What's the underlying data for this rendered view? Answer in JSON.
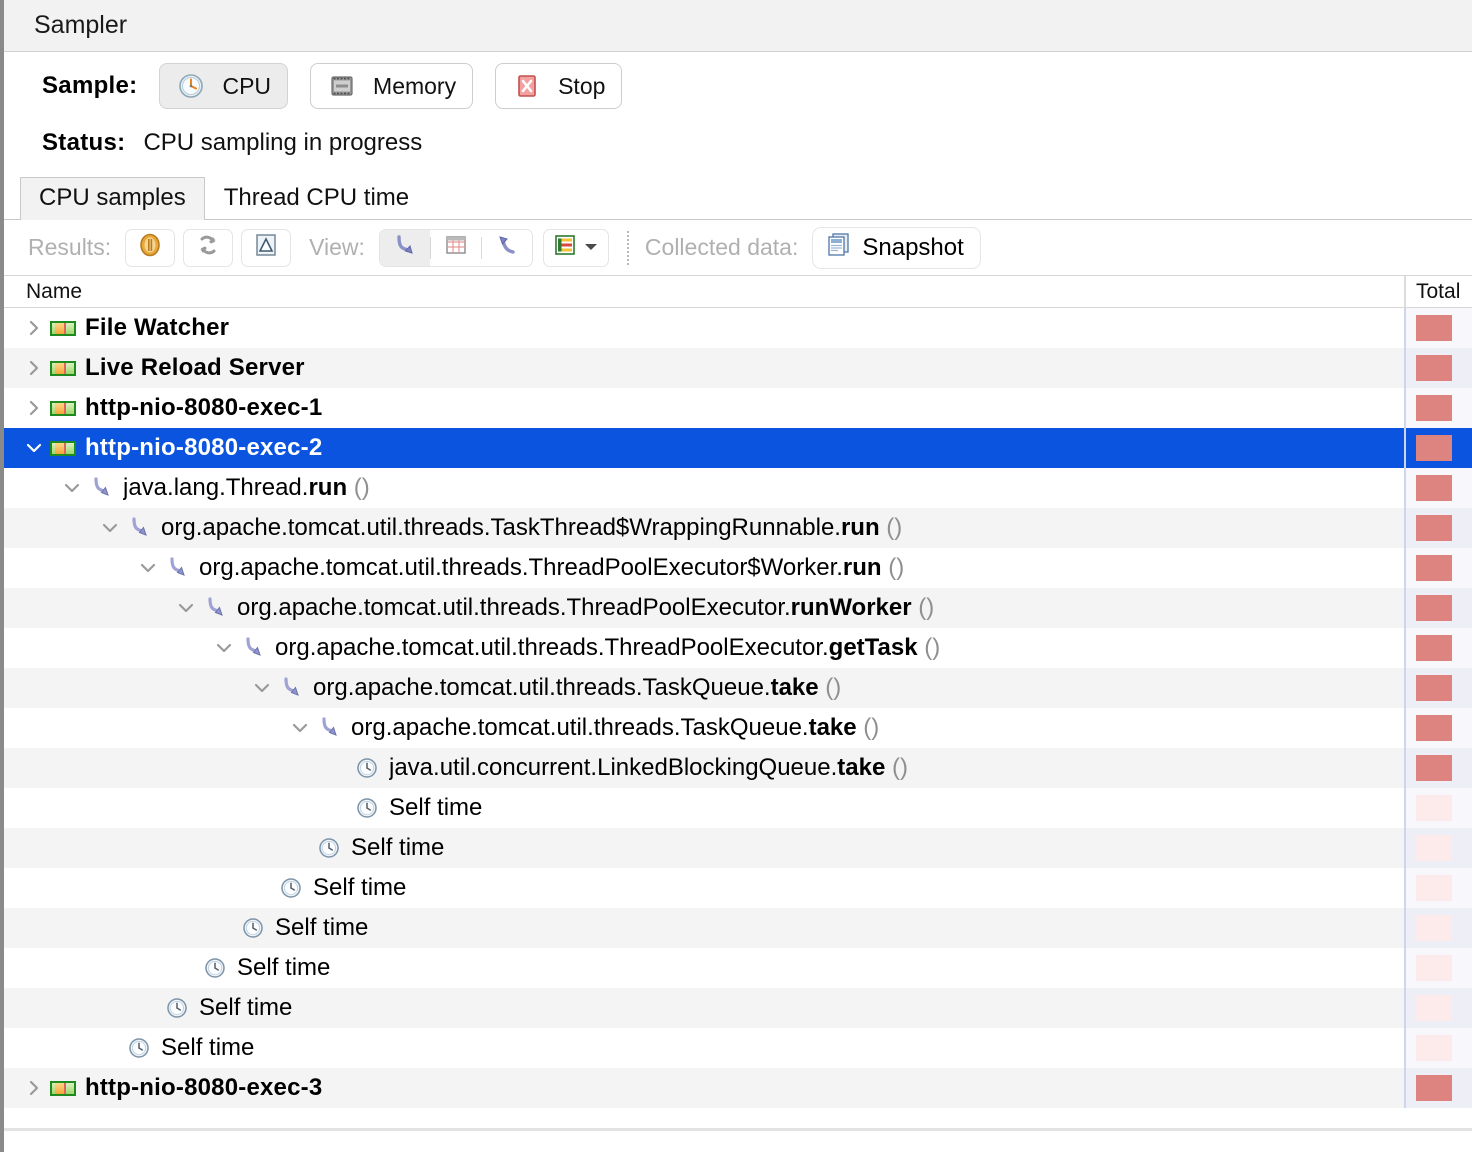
{
  "window": {
    "title": "Sampler"
  },
  "sample": {
    "label": "Sample:",
    "buttons": [
      {
        "label": "CPU",
        "icon": "clock-icon",
        "selected": true
      },
      {
        "label": "Memory",
        "icon": "memory-chip-icon",
        "selected": false
      },
      {
        "label": "Stop",
        "icon": "stop-x-icon",
        "selected": false
      }
    ]
  },
  "status": {
    "label": "Status:",
    "text": "CPU sampling in progress"
  },
  "tabs": [
    {
      "label": "CPU samples",
      "active": true
    },
    {
      "label": "Thread CPU time",
      "active": false
    }
  ],
  "toolbar": {
    "results_label": "Results:",
    "view_label": "View:",
    "collected_label": "Collected data:",
    "snapshot_label": "Snapshot",
    "buttons": [
      {
        "name": "pause-results-button",
        "icon": "pause-icon"
      },
      {
        "name": "refresh-results-button",
        "icon": "refresh-icon"
      },
      {
        "name": "delta-results-button",
        "icon": "delta-icon"
      },
      {
        "name": "view-call-tree-button",
        "icon": "call-tree-arrow-icon",
        "selected": true
      },
      {
        "name": "view-hot-spots-button",
        "icon": "grid-table-icon",
        "selected": false
      },
      {
        "name": "view-back-traces-button",
        "icon": "back-trace-arrow-icon",
        "selected": false
      },
      {
        "name": "aggregation-dropdown",
        "icon": "aggregation-icon"
      }
    ]
  },
  "table": {
    "columns": {
      "name": "Name",
      "total": "Total"
    },
    "rows": [
      {
        "indent": 0,
        "twisty": "collapsed",
        "icon": "thread-icon",
        "kind": "thread",
        "text": "File Watcher",
        "bar": "full"
      },
      {
        "indent": 0,
        "twisty": "collapsed",
        "icon": "thread-icon",
        "kind": "thread",
        "text": "Live Reload Server",
        "bar": "full"
      },
      {
        "indent": 0,
        "twisty": "collapsed",
        "icon": "thread-icon",
        "kind": "thread",
        "text": "http-nio-8080-exec-1",
        "bar": "full"
      },
      {
        "indent": 0,
        "twisty": "expanded",
        "icon": "thread-icon",
        "kind": "thread",
        "text": "http-nio-8080-exec-2",
        "bar": "full",
        "selected": true
      },
      {
        "indent": 1,
        "twisty": "expanded",
        "icon": "method-icon",
        "kind": "method",
        "pkg": "java.lang.Thread.",
        "method": "run",
        "paren": "()",
        "bar": "full"
      },
      {
        "indent": 2,
        "twisty": "expanded",
        "icon": "method-icon",
        "kind": "method",
        "pkg": "org.apache.tomcat.util.threads.TaskThread$WrappingRunnable.",
        "method": "run",
        "paren": "()",
        "bar": "full"
      },
      {
        "indent": 3,
        "twisty": "expanded",
        "icon": "method-icon",
        "kind": "method",
        "pkg": "org.apache.tomcat.util.threads.ThreadPoolExecutor$Worker.",
        "method": "run",
        "paren": "()",
        "bar": "full"
      },
      {
        "indent": 4,
        "twisty": "expanded",
        "icon": "method-icon",
        "kind": "method",
        "pkg": "org.apache.tomcat.util.threads.ThreadPoolExecutor.",
        "method": "runWorker",
        "paren": "()",
        "bar": "full"
      },
      {
        "indent": 5,
        "twisty": "expanded",
        "icon": "method-icon",
        "kind": "method",
        "pkg": "org.apache.tomcat.util.threads.ThreadPoolExecutor.",
        "method": "getTask",
        "paren": "()",
        "bar": "full"
      },
      {
        "indent": 6,
        "twisty": "expanded",
        "icon": "method-icon",
        "kind": "method",
        "pkg": "org.apache.tomcat.util.threads.TaskQueue.",
        "method": "take",
        "paren": "()",
        "bar": "full"
      },
      {
        "indent": 7,
        "twisty": "expanded",
        "icon": "method-icon",
        "kind": "method",
        "pkg": "org.apache.tomcat.util.threads.TaskQueue.",
        "method": "take",
        "paren": "()",
        "bar": "full"
      },
      {
        "indent": 8,
        "twisty": "none",
        "icon": "clock-icon",
        "kind": "method",
        "pkg": "java.util.concurrent.LinkedBlockingQueue.",
        "method": "take",
        "paren": "()",
        "bar": "full"
      },
      {
        "indent": 8,
        "twisty": "none",
        "icon": "clock-icon",
        "kind": "selftime",
        "text": "Self time",
        "bar": "light"
      },
      {
        "indent": 7,
        "twisty": "none",
        "icon": "clock-icon",
        "kind": "selftime",
        "text": "Self time",
        "bar": "light"
      },
      {
        "indent": 6,
        "twisty": "none",
        "icon": "clock-icon",
        "kind": "selftime",
        "text": "Self time",
        "bar": "light"
      },
      {
        "indent": 5,
        "twisty": "none",
        "icon": "clock-icon",
        "kind": "selftime",
        "text": "Self time",
        "bar": "light"
      },
      {
        "indent": 4,
        "twisty": "none",
        "icon": "clock-icon",
        "kind": "selftime",
        "text": "Self time",
        "bar": "light"
      },
      {
        "indent": 3,
        "twisty": "none",
        "icon": "clock-icon",
        "kind": "selftime",
        "text": "Self time",
        "bar": "light"
      },
      {
        "indent": 2,
        "twisty": "none",
        "icon": "clock-icon",
        "kind": "selftime",
        "text": "Self time",
        "bar": "light"
      },
      {
        "indent": 0,
        "twisty": "collapsed",
        "icon": "thread-icon",
        "kind": "thread",
        "text": "http-nio-8080-exec-3",
        "bar": "full"
      }
    ]
  },
  "colors": {
    "selection": "#0b54df",
    "bar_full": "#dd8380",
    "bar_light": "#fdeaea",
    "thread_icon_green": "#1f8a1f",
    "thread_icon_orange": "#f2a63a"
  }
}
